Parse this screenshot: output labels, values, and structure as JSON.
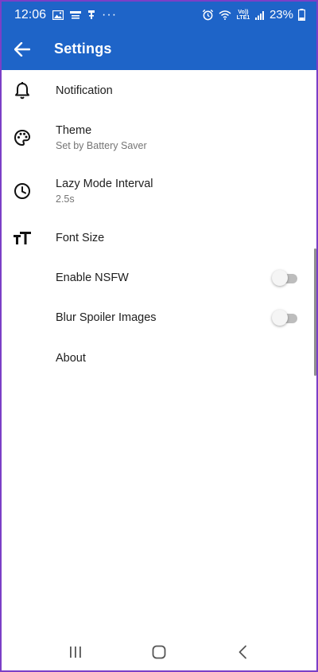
{
  "status_bar": {
    "time": "12:06",
    "battery_percent": "23%",
    "network_label": "Vo)) LTE1",
    "more_dots": "···"
  },
  "app_bar": {
    "title": "Settings",
    "back_icon": "arrow-back-icon"
  },
  "settings": [
    {
      "id": "notification",
      "title": "Notification",
      "subtitle": "",
      "icon": "bell-icon",
      "has_toggle": false
    },
    {
      "id": "theme",
      "title": "Theme",
      "subtitle": "Set by Battery Saver",
      "icon": "palette-icon",
      "has_toggle": false
    },
    {
      "id": "lazy-mode",
      "title": "Lazy Mode Interval",
      "subtitle": "2.5s",
      "icon": "clock-icon",
      "has_toggle": false
    },
    {
      "id": "font-size",
      "title": "Font Size",
      "subtitle": "",
      "icon": "text-size-icon",
      "has_toggle": false
    },
    {
      "id": "enable-nsfw",
      "title": "Enable NSFW",
      "subtitle": "",
      "icon": "",
      "has_toggle": true,
      "toggle_on": false
    },
    {
      "id": "blur-spoiler",
      "title": "Blur Spoiler Images",
      "subtitle": "",
      "icon": "",
      "has_toggle": true,
      "toggle_on": false
    },
    {
      "id": "about",
      "title": "About",
      "subtitle": "",
      "icon": "",
      "has_toggle": false
    }
  ],
  "nav_bar": {
    "recents_icon": "recents-icon",
    "home_icon": "home-icon",
    "back_icon": "nav-back-icon"
  },
  "colors": {
    "primary": "#1e64c8",
    "frame_border": "#7b3fc7",
    "text_primary": "#202020",
    "text_secondary": "#757575",
    "toggle_off_track": "#bdbdbd"
  }
}
